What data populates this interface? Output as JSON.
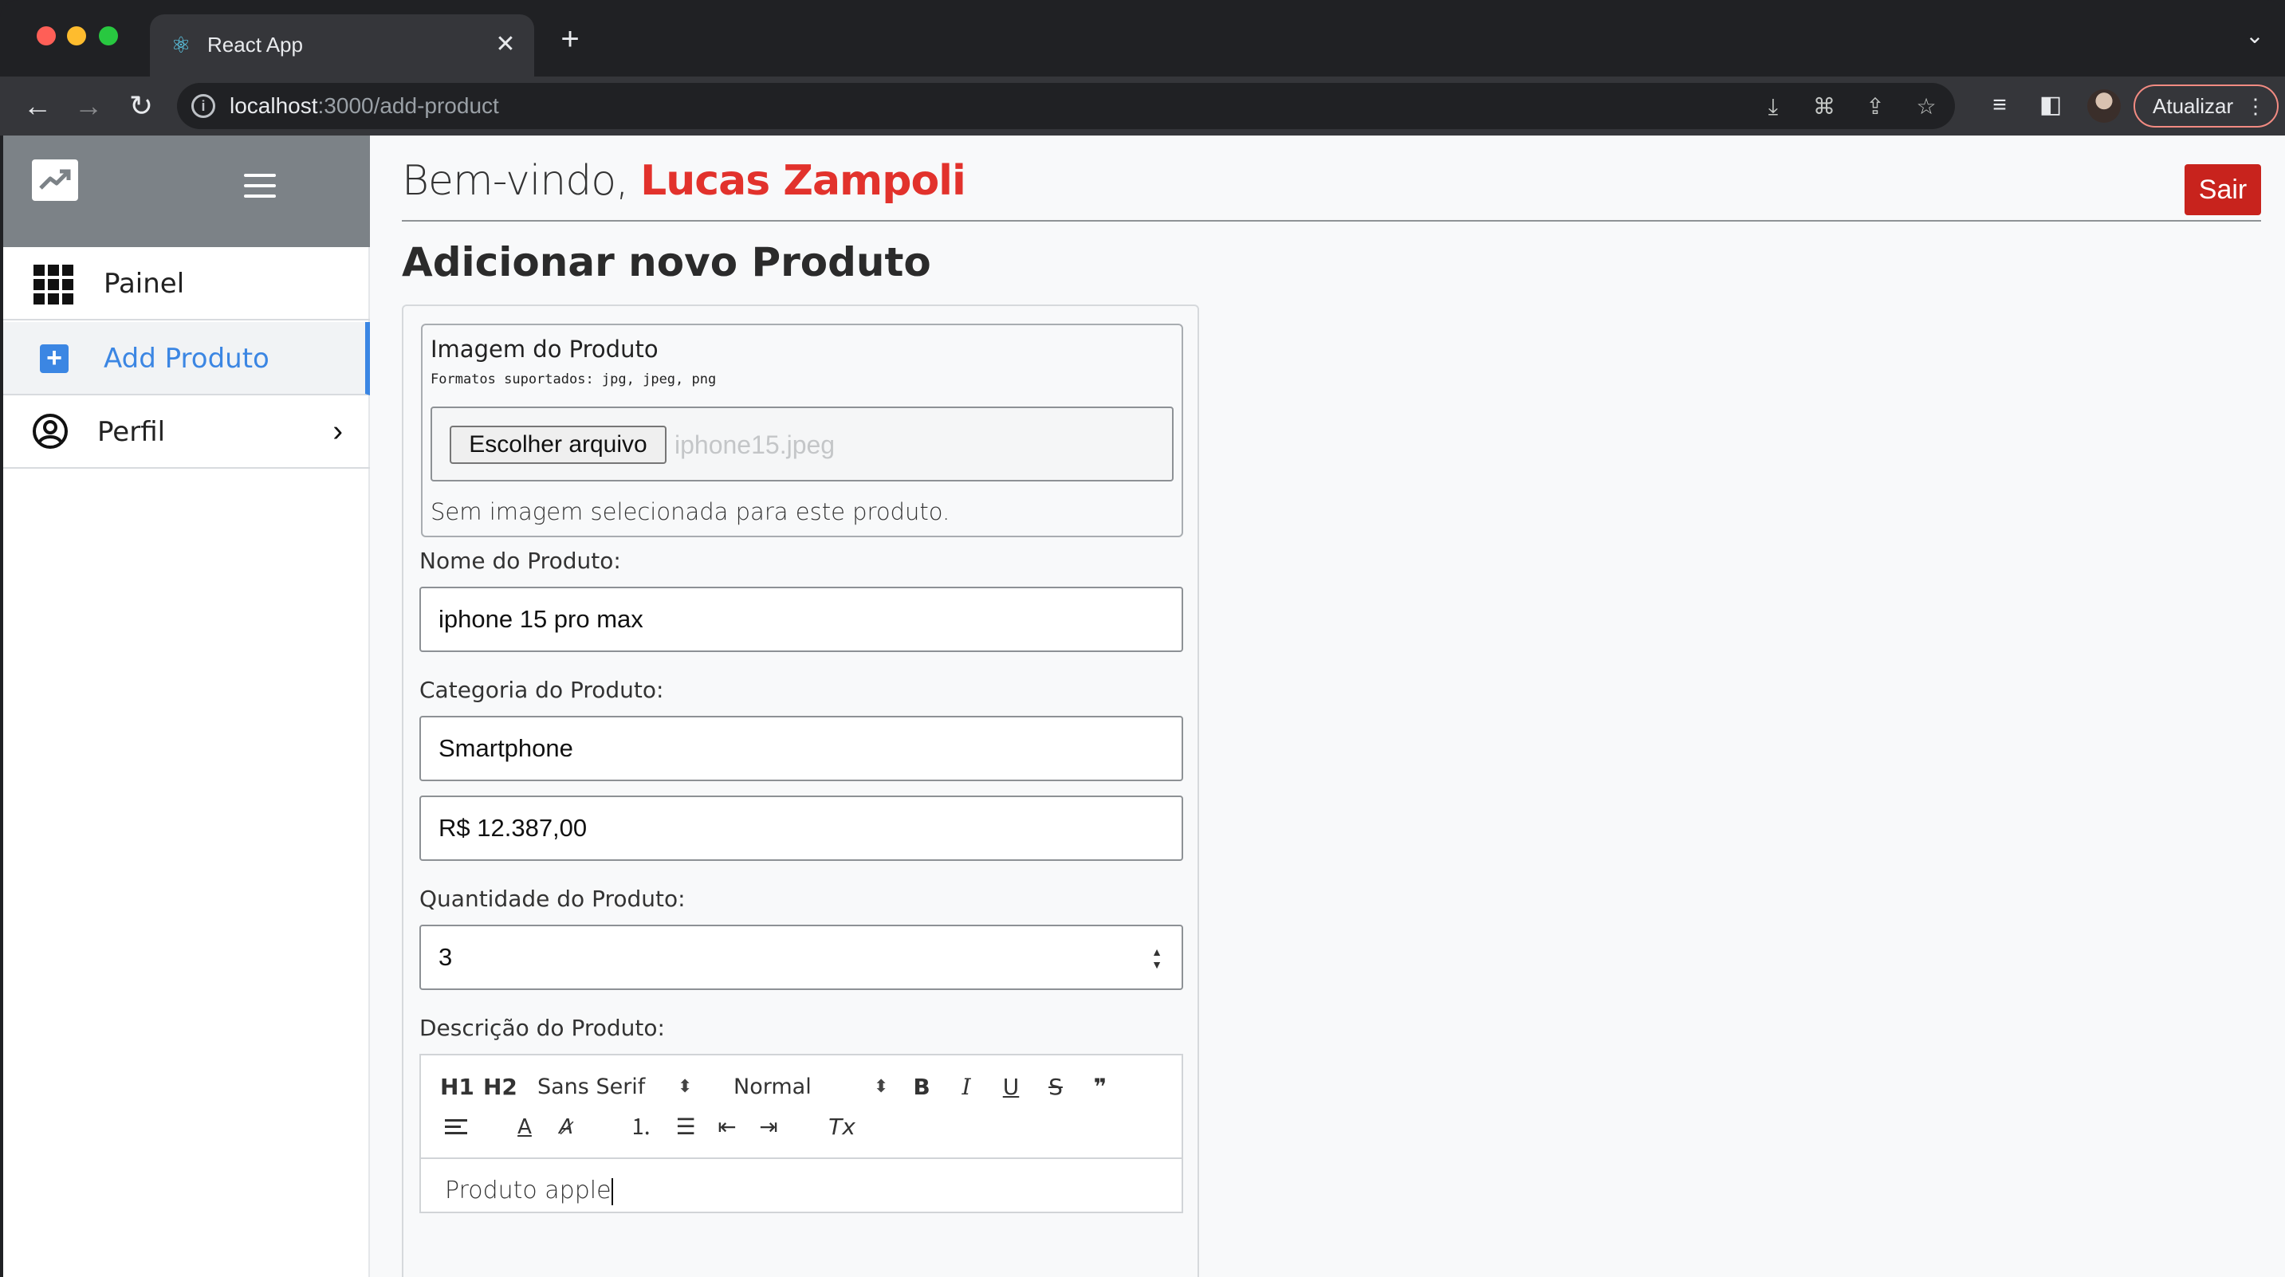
{
  "browser": {
    "tab_title": "React App",
    "url_host": "localhost",
    "url_rest": ":3000/add-product",
    "update_label": "Atualizar"
  },
  "sidebar": {
    "items": [
      {
        "label": "Painel"
      },
      {
        "label": "Add Produto"
      },
      {
        "label": "Perfil"
      }
    ]
  },
  "header": {
    "welcome_prefix": "Bem-vindo, ",
    "user_name": "Lucas Zampoli",
    "logout_label": "Sair"
  },
  "page": {
    "title": "Adicionar novo Produto"
  },
  "form": {
    "image_section": {
      "legend": "Imagem do Produto",
      "formats": "Formatos suportados: jpg, jpeg, png",
      "file_button": "Escolher arquivo",
      "file_name": "iphone15.jpeg",
      "note": "Sem imagem selecionada para este produto."
    },
    "name_label": "Nome do Produto:",
    "name_value": "iphone 15 pro max",
    "category_label": "Categoria do Produto:",
    "category_value": "Smartphone",
    "price_value": "R$ 12.387,00",
    "quantity_label": "Quantidade do Produto:",
    "quantity_value": "3",
    "description_label": "Descrição do Produto:",
    "editor": {
      "h1": "H1",
      "h2": "H2",
      "font": "Sans Serif",
      "size": "Normal",
      "bold": "B",
      "italic": "I",
      "underline": "U",
      "strike": "S",
      "quote": "❞",
      "clear": "Tx",
      "content": "Produto apple"
    }
  },
  "colors": {
    "accent": "#3b86e3",
    "brand_red": "#e2322c",
    "logout_bg": "#c8231d",
    "sidebar_header": "#7c8287"
  }
}
